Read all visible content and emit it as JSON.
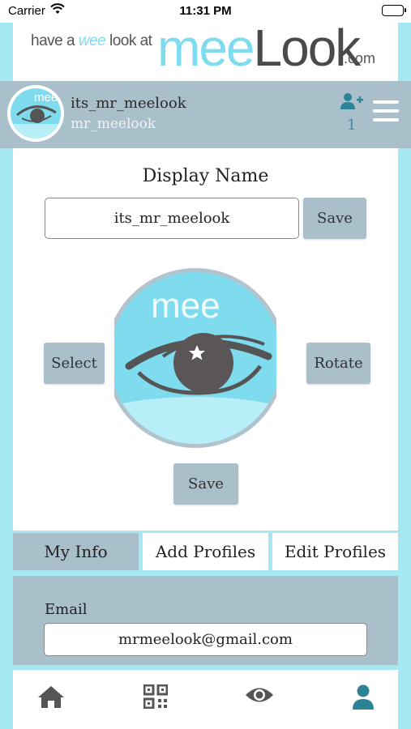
{
  "status_bar": {
    "carrier": "Carrier",
    "time": "11:31 PM"
  },
  "banner": {
    "tagline_prefix": "have a ",
    "tagline_wee": "wee",
    "tagline_suffix": " look at",
    "brand_a": "mee",
    "brand_b": "Look",
    "dotcom": ".com"
  },
  "profile": {
    "display_name": "its_mr_meelook",
    "username": "mr_meelook",
    "follow_count": "1"
  },
  "editor": {
    "title": "Display Name",
    "name_value": "its_mr_meelook",
    "save_label": "Save",
    "select_label": "Select",
    "rotate_label": "Rotate",
    "save_image_label": "Save",
    "avatar_text": "mee"
  },
  "tabs": [
    {
      "label": "My Info",
      "active": true
    },
    {
      "label": "Add Profiles",
      "active": false
    },
    {
      "label": "Edit Profiles",
      "active": false
    }
  ],
  "info": {
    "email_label": "Email",
    "email_value": "mrmeelook@gmail.com"
  },
  "bottom_nav": [
    {
      "icon": "home-icon"
    },
    {
      "icon": "qr-code-icon"
    },
    {
      "icon": "eye-icon"
    },
    {
      "icon": "profile-icon"
    }
  ],
  "colors": {
    "accent": "#a6e8f2",
    "panel_gray": "#a9bfc9",
    "teal": "#2c8396",
    "brand_cyan": "#7fdcef"
  }
}
